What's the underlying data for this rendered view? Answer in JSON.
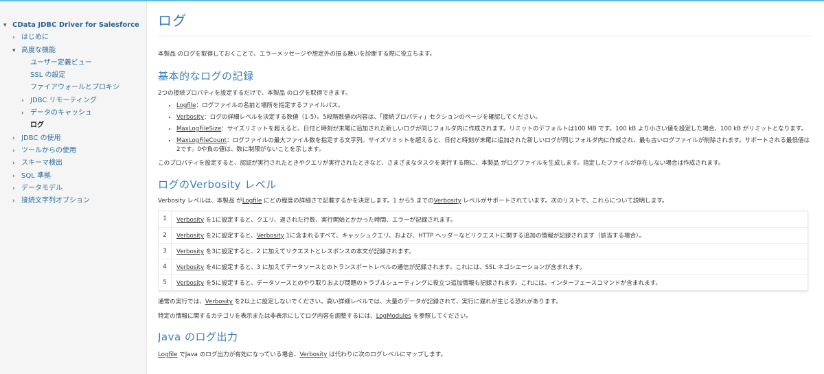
{
  "sidebar": {
    "items": [
      {
        "label": "CData JDBC Driver for Salesforce",
        "chevron": "▾",
        "level": "root"
      },
      {
        "label": "はじめに",
        "chevron": "›",
        "level": "lvl0"
      },
      {
        "label": "高度な機能",
        "chevron": "▾",
        "level": "lvl0"
      },
      {
        "label": "ユーザー定義ビュー",
        "chevron": "",
        "level": "lvl2"
      },
      {
        "label": "SSL の設定",
        "chevron": "",
        "level": "lvl2"
      },
      {
        "label": "ファイアウォールとプロキシ",
        "chevron": "",
        "level": "lvl2"
      },
      {
        "label": "JDBC リモーティング",
        "chevron": "›",
        "level": "lvl2"
      },
      {
        "label": "データのキャッシュ",
        "chevron": "›",
        "level": "lvl2"
      },
      {
        "label": "ログ",
        "chevron": "",
        "level": "lvl2"
      },
      {
        "label": "JDBC の使用",
        "chevron": "›",
        "level": "lvl0"
      },
      {
        "label": "ツールからの使用",
        "chevron": "›",
        "level": "lvl0"
      },
      {
        "label": "スキーマ検出",
        "chevron": "›",
        "level": "lvl0"
      },
      {
        "label": "SQL 準拠",
        "chevron": "›",
        "level": "lvl0"
      },
      {
        "label": "データモデル",
        "chevron": "›",
        "level": "lvl0"
      },
      {
        "label": "接続文字列オプション",
        "chevron": "›",
        "level": "lvl0"
      }
    ]
  },
  "page": {
    "title": "ログ",
    "intro": "本製品 のログを取得しておくことで、エラーメッセージや想定外の振る舞いを診断する際に役立ちます。",
    "basic": {
      "heading": "基本的なログの記録",
      "lead": "2つの接続プロパティを設定するだけで、本製品 のログを取得できます。",
      "props": [
        {
          "name": "Logfile",
          "desc": "：ログファイルの名前と場所を指定するファイルパス。"
        },
        {
          "name": "Verbosity",
          "desc": "：ログの詳細レベルを決定する数値（1-5）。5段階数値の内容は、「接続プロパティ」セクションのページを確認してください。"
        },
        {
          "name": "MaxLogFileSize",
          "desc": "：サイズリミットを超えると、日付と時刻が末尾に追加された新しいログが同じフォルダ内に作成されます。リミットのデフォルトは100 MB です。100 kB より小さい値を設定した場合、100 kB がリミットとなります。"
        },
        {
          "name": "MaxLogFileCount",
          "desc": "：ログファイルの最大ファイル数を指定する文字列。サイズリミットを超えると、日付と時刻が末尾に追加された新しいログが同じフォルダ内に作成され、最も古いログファイルが削除されます。サポートされる最低値は2です。0や負の値は、数に制限がないことを示します。"
        }
      ],
      "after": "このプロパティを設定すると、認証が実行されたときやクエリが実行されたときなど、さまざまなタスクを実行する際に、本製品 がログファイルを生成します。指定したファイルが存在しない場合は作成されます。"
    },
    "verbosity": {
      "heading": "ログのVerbosity レベル",
      "lead_a": "Verbosity レベルは、本製品 が",
      "lead_link1": "Logfile",
      "lead_b": " にどの程度の詳細さで記載するかを決定します。1 から5 までの",
      "lead_link2": "Verbosity",
      "lead_c": " レベルがサポートされています。次のリストで、これらについて説明します。",
      "rows": [
        {
          "num": "1",
          "link": "Verbosity",
          "text": " を1に設定すると、クエリ、返された行数、実行開始とかかった時間、エラーが記録されます。",
          "link2": "",
          "text2": ""
        },
        {
          "num": "2",
          "link": "Verbosity",
          "text": " を2に設定すると、",
          "link2": "Verbosity",
          "text2": " 1に含まれるすべて、キャッシュクエリ、および、HTTP ヘッダーなどリクエストに関する追加の情報が記録されます（該当する場合）。"
        },
        {
          "num": "3",
          "link": "Verbosity",
          "text": " を3に設定すると、2 に加えてリクエストとレスポンスの本文が記録されます。",
          "link2": "",
          "text2": ""
        },
        {
          "num": "4",
          "link": "Verbosity",
          "text": " を4に設定すると、3 に加えてデータソースとのトランスポートレベルの通信が記録されます。これには、SSL ネゴシエーションが含まれます。",
          "link2": "",
          "text2": ""
        },
        {
          "num": "5",
          "link": "Verbosity",
          "text": " を5に設定すると、データソースとのやり取りおよび問題のトラブルシューティングに役立つ追加情報も記録されます。これには、インターフェースコマンドが含まれます。",
          "link2": "",
          "text2": ""
        }
      ],
      "note1_a": "通常の実行では、",
      "note1_link": "Verbosity",
      "note1_b": " を2以上に設定しないでください。高い詳細レベルでは、大量のデータが記録されて、実行に遅れが生じる恐れがあります。",
      "note2_a": "特定の情報に関するカテゴリを表示または非表示にしてログ内容を調整するには、",
      "note2_link": "LogModules",
      "note2_b": " を参照してください。"
    },
    "java": {
      "heading": "Java のログ出力",
      "link1": "Logfile",
      "text_a": " でJava のログ出力が有効になっている場合、",
      "link2": "Verbosity",
      "text_b": " は代わりに次のログレベルにマップします。"
    }
  },
  "colors": {
    "accent": "#3a7cbf",
    "topbar": "#5bc0de",
    "sidebar_bg": "#f5f5f5",
    "link": "#2a6f9e"
  }
}
